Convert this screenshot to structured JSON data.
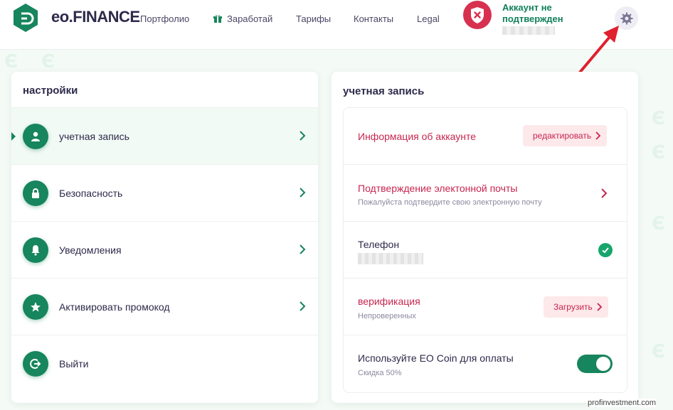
{
  "header": {
    "logo_text": "eo.FINANCE",
    "nav": [
      "Портфолио",
      "Заработай",
      "Тарифы",
      "Контакты",
      "Legal"
    ],
    "account_status": "Аккаунт не подтвержден"
  },
  "settings": {
    "title": "настройки",
    "items": [
      {
        "label": "учетная запись",
        "icon": "user-icon"
      },
      {
        "label": "Безопасность",
        "icon": "lock-icon"
      },
      {
        "label": "Уведомления",
        "icon": "bell-icon"
      },
      {
        "label": "Активировать промокод",
        "icon": "star-icon"
      },
      {
        "label": "Выйти",
        "icon": "logout-icon"
      }
    ]
  },
  "account": {
    "title": "учетная запись",
    "info_title": "Информация об аккаунте",
    "edit_label": "редактировать",
    "email_title": "Подтверждение электонной почты",
    "email_sub": "Пожалуйста подтвердите свою электронную почту",
    "phone_title": "Телефон",
    "verification_title": "верификация",
    "verification_sub": "Непроверенных",
    "upload_label": "Загрузить",
    "eo_coin_title": "Используйте EO Coin для оплаты",
    "eo_coin_sub": "Скидка 50%",
    "eo_coin_enabled": true
  },
  "footer": {
    "domain": "profinvestment.com"
  },
  "colors": {
    "brand_green": "#17855d",
    "accent_red": "#c7264f",
    "text": "#2d2a4a"
  }
}
